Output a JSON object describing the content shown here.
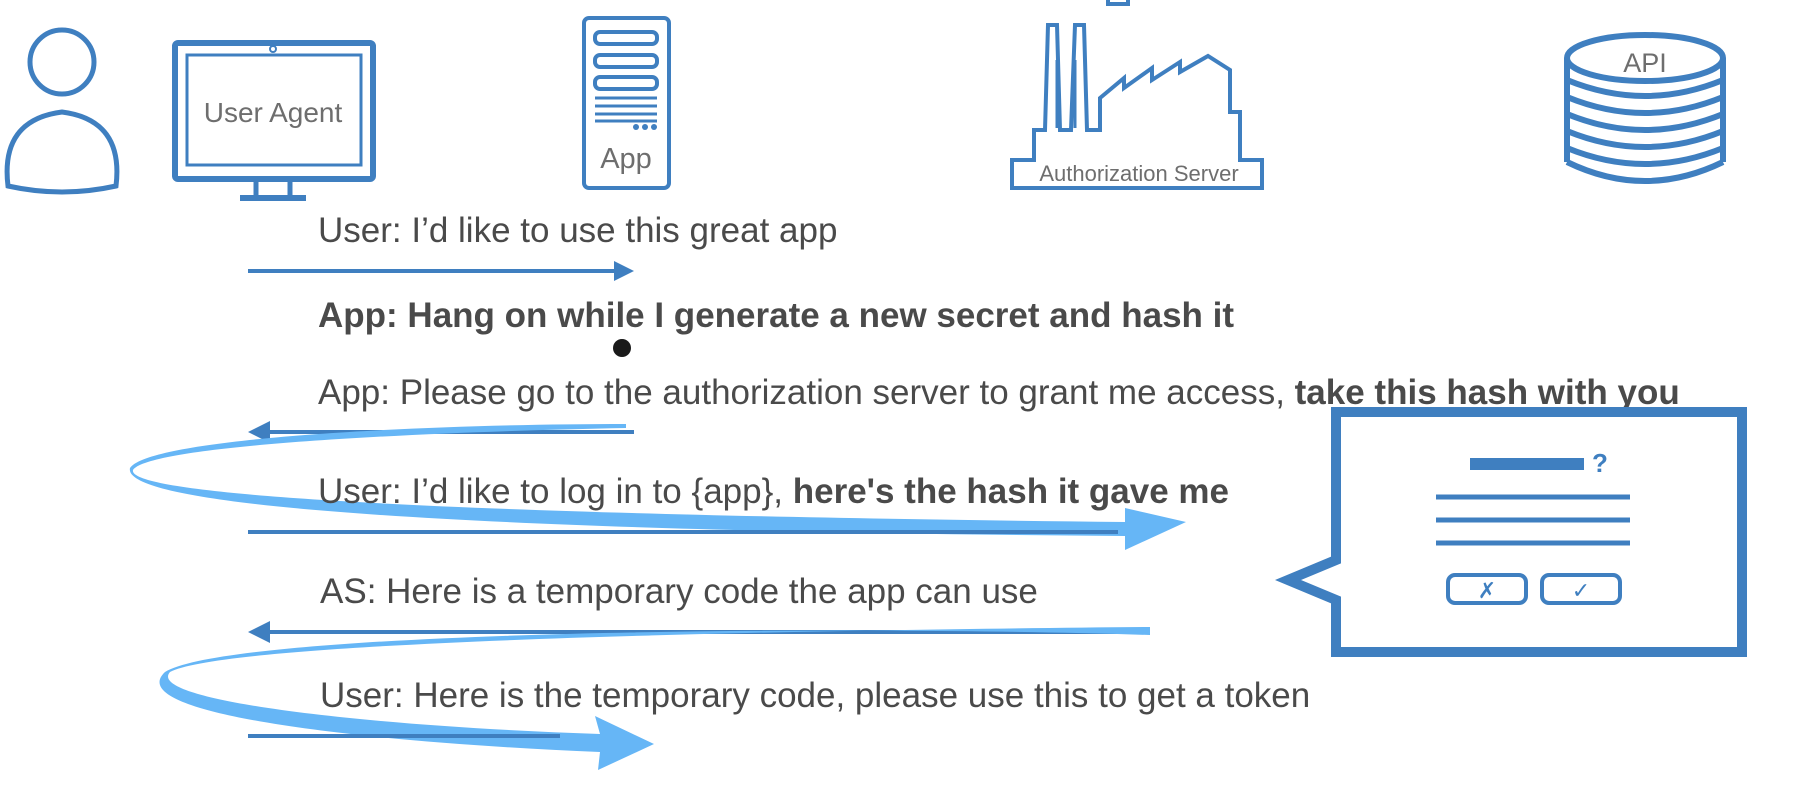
{
  "colors": {
    "actor": "#3f7fc0",
    "arrow": "#3f7fc0",
    "swoosh": "#66b6f6",
    "text": "#4a4a4a",
    "label": "#6e6e6e"
  },
  "actors": {
    "user": {
      "icon": "person-icon"
    },
    "user_agent": {
      "label": "User Agent",
      "icon": "monitor-icon"
    },
    "app": {
      "label": "App",
      "icon": "server-icon"
    },
    "auth_server": {
      "label": "Authorization Server",
      "icon": "factory-icon"
    },
    "api": {
      "label": "API",
      "icon": "database-icon"
    }
  },
  "messages": {
    "m1": {
      "text": "User: I’d like to use this great app"
    },
    "m2": {
      "text": "App: Hang on while I generate a new secret and hash it"
    },
    "m3": {
      "text": "App: Please go to the authorization server to grant me access, ",
      "bold": "take this hash with you"
    },
    "m4": {
      "text": "User: I’d like to log in to {app}, ",
      "bold": "here's the hash it gave me"
    },
    "m5": {
      "text": "AS: Here is a temporary code the app can use"
    },
    "m6": {
      "text": "User: Here is the temporary code, please use this to get a token"
    }
  },
  "consent_dialog": {
    "question_mark": "?",
    "cancel_glyph": "✗",
    "confirm_glyph": "✓"
  }
}
